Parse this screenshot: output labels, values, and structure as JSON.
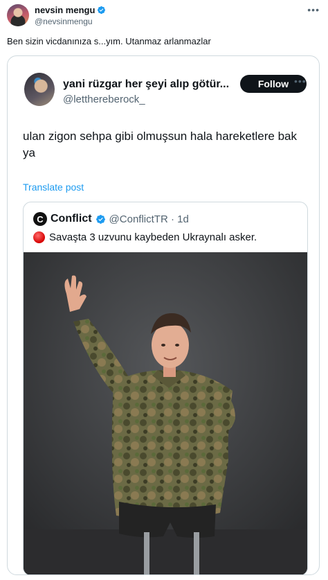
{
  "post": {
    "display_name": "nevsin mengu",
    "handle": "@nevsinmengu",
    "text": "Ben sizin vicdanınıza s...yım. Utanmaz arlanmazlar"
  },
  "quoted": {
    "display_name": "yani rüzgar her şeyi alıp götür...",
    "handle": "@letthereberock_",
    "follow_label": "Follow",
    "text": "ulan zigon sehpa gibi olmuşsun hala hareketlere bak ya",
    "translate_label": "Translate post",
    "nested": {
      "logo_letter": "C",
      "display_name": "Conflict",
      "meta": "@ConflictTR · 1d",
      "text": "Savaşta 3 uzvunu kaybeden Ukraynalı asker."
    }
  },
  "colors": {
    "verified": "#1d9bf0",
    "link": "#1d9bf0",
    "follow_bg": "#0f1419",
    "secondary_text": "#536471"
  },
  "icons": [
    "verified-icon",
    "more-icon",
    "red-circle-icon"
  ]
}
